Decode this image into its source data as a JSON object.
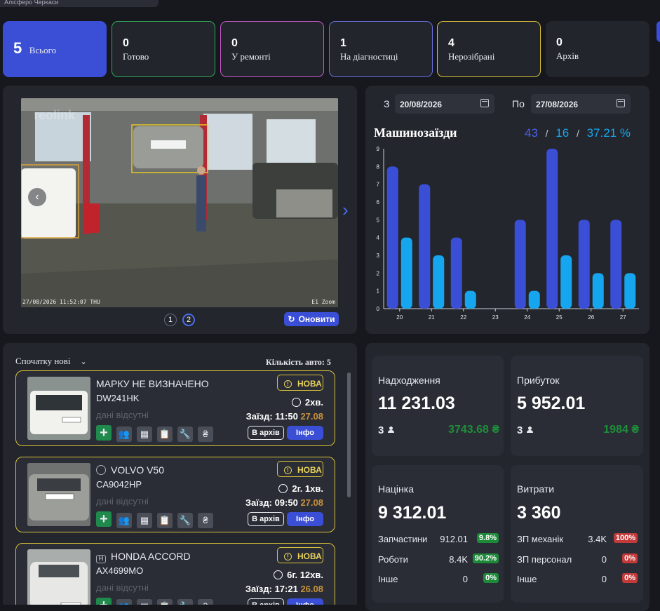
{
  "top_strip": {
    "text": "Алісферо Черкаси"
  },
  "stats": [
    {
      "count": "5",
      "label": "Всього",
      "color": "#3b4fd6"
    },
    {
      "count": "0",
      "label": "Готово",
      "color": "#2fa85a"
    },
    {
      "count": "0",
      "label": "У ремонті",
      "color": "#c45ac8"
    },
    {
      "count": "1",
      "label": "На діагностиці",
      "color": "#6a6fe0"
    },
    {
      "count": "4",
      "label": "Нерозібрані",
      "color": "#d9c23a"
    },
    {
      "count": "0",
      "label": "Архів",
      "color": "#2a2d35"
    }
  ],
  "camera": {
    "timestamp": "27/08/2026 11:52:07 THU",
    "zoom_label": "E1 Zoom",
    "watermark": "reolink",
    "pages": [
      "1",
      "2"
    ],
    "active_page": "2",
    "refresh_label": "Оновити"
  },
  "chart_panel": {
    "from_label": "З",
    "from_date": "20/08/2026",
    "to_label": "По",
    "to_date": "27/08/2026",
    "title": "Машинозаїзди",
    "total": "43",
    "sep1": "/",
    "second": "16",
    "sep2": "/",
    "percent": "37.21 %"
  },
  "chart_data": {
    "type": "bar",
    "categories": [
      "20",
      "21",
      "22",
      "23",
      "24",
      "25",
      "26",
      "27"
    ],
    "series": [
      {
        "values": [
          8,
          7,
          4,
          0,
          5,
          9,
          5,
          5
        ],
        "color": "#3b4fd6"
      },
      {
        "values": [
          4,
          3,
          1,
          0,
          1,
          3,
          2,
          2
        ],
        "color": "#16a6f0"
      }
    ],
    "ylim": [
      0,
      9
    ],
    "yticks": [
      "0",
      "1",
      "2",
      "3",
      "4",
      "5",
      "6",
      "7",
      "8",
      "9"
    ]
  },
  "list": {
    "sort_label": "Спочатку нові",
    "count_label": "Кількість авто: 5",
    "cars": [
      {
        "title": "МАРКУ НЕ ВИЗНАЧЕНО",
        "plate": "DW241HK",
        "nodata": "дані відсутні",
        "status": "НОВА",
        "elapsed": "2хв.",
        "arrive_label": "Заїзд:",
        "arrive_time": "11:50",
        "arrive_date": "27.08",
        "archive": "В архів",
        "info": "Інфо"
      },
      {
        "title": "VOLVO V50",
        "plate": "CA9042HP",
        "nodata": "дані відсутні",
        "status": "НОВА",
        "elapsed": "2г. 1хв.",
        "arrive_label": "Заїзд:",
        "arrive_time": "09:50",
        "arrive_date": "27.08",
        "archive": "В архів",
        "info": "Інфо"
      },
      {
        "title": "HONDA ACCORD",
        "plate": "AX4699MO",
        "nodata": "дані відсутні",
        "status": "НОВА",
        "elapsed": "6г. 12хв.",
        "arrive_label": "Заїзд:",
        "arrive_time": "17:21",
        "arrive_date": "26.08",
        "archive": "В архів",
        "info": "Інфо"
      }
    ],
    "hryvnia": "₴"
  },
  "finance": {
    "income": {
      "title": "Надходження",
      "value": "11 231.03",
      "count": "3",
      "green": "3743.68 ₴"
    },
    "profit": {
      "title": "Прибуток",
      "value": "5 952.01",
      "count": "3",
      "green": "1984 ₴"
    },
    "markup": {
      "title": "Націнка",
      "value": "9 312.01",
      "rows": [
        {
          "label": "Запчастини",
          "value": "912.01",
          "pct": "9.8%"
        },
        {
          "label": "Роботи",
          "value": "8.4K",
          "pct": "90.2%"
        },
        {
          "label": "Інше",
          "value": "0",
          "pct": "0%"
        }
      ]
    },
    "expenses": {
      "title": "Витрати",
      "value": "3 360",
      "rows": [
        {
          "label": "ЗП механік",
          "value": "3.4K",
          "pct": "100%"
        },
        {
          "label": "ЗП персонал",
          "value": "0",
          "pct": "0%"
        },
        {
          "label": "Інше",
          "value": "0",
          "pct": "0%"
        }
      ]
    }
  }
}
